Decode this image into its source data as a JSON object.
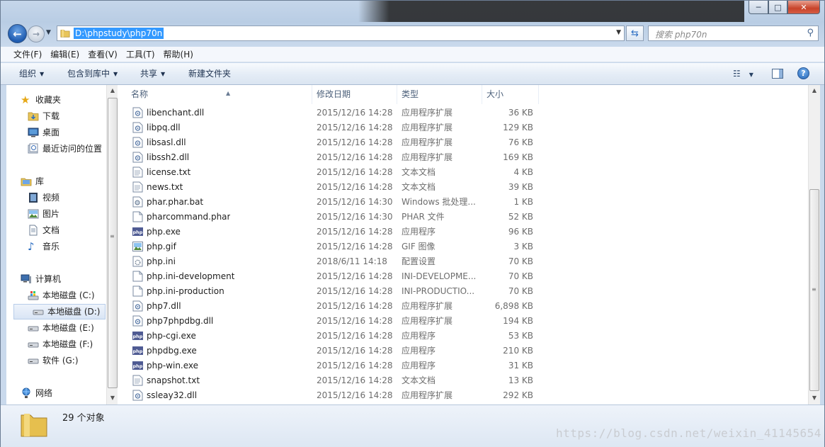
{
  "window": {
    "controls": {
      "minimize": "─",
      "maximize": "□",
      "close": "✕"
    }
  },
  "address_bar": {
    "path": "D:\\phpstudy\\php70n",
    "search_placeholder": "搜索 php70n"
  },
  "menu": [
    "文件(F)",
    "编辑(E)",
    "查看(V)",
    "工具(T)",
    "帮助(H)"
  ],
  "command_bar": {
    "organize": "组织",
    "include_in_library": "包含到库中",
    "share": "共享",
    "new_folder": "新建文件夹",
    "help": "?"
  },
  "nav_pane": {
    "favorites": {
      "label": "收藏夹",
      "items": [
        "下载",
        "桌面",
        "最近访问的位置"
      ]
    },
    "libraries": {
      "label": "库",
      "items": [
        "视频",
        "图片",
        "文档",
        "音乐"
      ]
    },
    "computer": {
      "label": "计算机",
      "items": [
        "本地磁盘 (C:)",
        "本地磁盘 (D:)",
        "本地磁盘 (E:)",
        "本地磁盘 (F:)",
        "软件 (G:)"
      ]
    },
    "network": {
      "label": "网络"
    },
    "selected": "本地磁盘 (D:)"
  },
  "columns": {
    "name": "名称",
    "date": "修改日期",
    "type": "类型",
    "size": "大小"
  },
  "files": [
    {
      "name": "libenchant.dll",
      "date": "2015/12/16 14:28",
      "type": "应用程序扩展",
      "size": "36 KB",
      "icon": "dll"
    },
    {
      "name": "libpq.dll",
      "date": "2015/12/16 14:28",
      "type": "应用程序扩展",
      "size": "129 KB",
      "icon": "dll"
    },
    {
      "name": "libsasl.dll",
      "date": "2015/12/16 14:28",
      "type": "应用程序扩展",
      "size": "76 KB",
      "icon": "dll"
    },
    {
      "name": "libssh2.dll",
      "date": "2015/12/16 14:28",
      "type": "应用程序扩展",
      "size": "169 KB",
      "icon": "dll"
    },
    {
      "name": "license.txt",
      "date": "2015/12/16 14:28",
      "type": "文本文档",
      "size": "4 KB",
      "icon": "txt"
    },
    {
      "name": "news.txt",
      "date": "2015/12/16 14:28",
      "type": "文本文档",
      "size": "39 KB",
      "icon": "txt"
    },
    {
      "name": "phar.phar.bat",
      "date": "2015/12/16 14:30",
      "type": "Windows 批处理...",
      "size": "1 KB",
      "icon": "bat"
    },
    {
      "name": "pharcommand.phar",
      "date": "2015/12/16 14:30",
      "type": "PHAR 文件",
      "size": "52 KB",
      "icon": "blank"
    },
    {
      "name": "php.exe",
      "date": "2015/12/16 14:28",
      "type": "应用程序",
      "size": "96 KB",
      "icon": "php"
    },
    {
      "name": "php.gif",
      "date": "2015/12/16 14:28",
      "type": "GIF 图像",
      "size": "3 KB",
      "icon": "gif"
    },
    {
      "name": "php.ini",
      "date": "2018/6/11 14:18",
      "type": "配置设置",
      "size": "70 KB",
      "icon": "ini"
    },
    {
      "name": "php.ini-development",
      "date": "2015/12/16 14:28",
      "type": "INI-DEVELOPME...",
      "size": "70 KB",
      "icon": "blank"
    },
    {
      "name": "php.ini-production",
      "date": "2015/12/16 14:28",
      "type": "INI-PRODUCTIO...",
      "size": "70 KB",
      "icon": "blank"
    },
    {
      "name": "php7.dll",
      "date": "2015/12/16 14:28",
      "type": "应用程序扩展",
      "size": "6,898 KB",
      "icon": "dll"
    },
    {
      "name": "php7phpdbg.dll",
      "date": "2015/12/16 14:28",
      "type": "应用程序扩展",
      "size": "194 KB",
      "icon": "dll"
    },
    {
      "name": "php-cgi.exe",
      "date": "2015/12/16 14:28",
      "type": "应用程序",
      "size": "53 KB",
      "icon": "php"
    },
    {
      "name": "phpdbg.exe",
      "date": "2015/12/16 14:28",
      "type": "应用程序",
      "size": "210 KB",
      "icon": "php"
    },
    {
      "name": "php-win.exe",
      "date": "2015/12/16 14:28",
      "type": "应用程序",
      "size": "31 KB",
      "icon": "php"
    },
    {
      "name": "snapshot.txt",
      "date": "2015/12/16 14:28",
      "type": "文本文档",
      "size": "13 KB",
      "icon": "txt"
    },
    {
      "name": "ssleay32.dll",
      "date": "2015/12/16 14:28",
      "type": "应用程序扩展",
      "size": "292 KB",
      "icon": "dll"
    }
  ],
  "status": {
    "count": "29 个对象"
  },
  "watermark": "https://blog.csdn.net/weixin_41145654"
}
